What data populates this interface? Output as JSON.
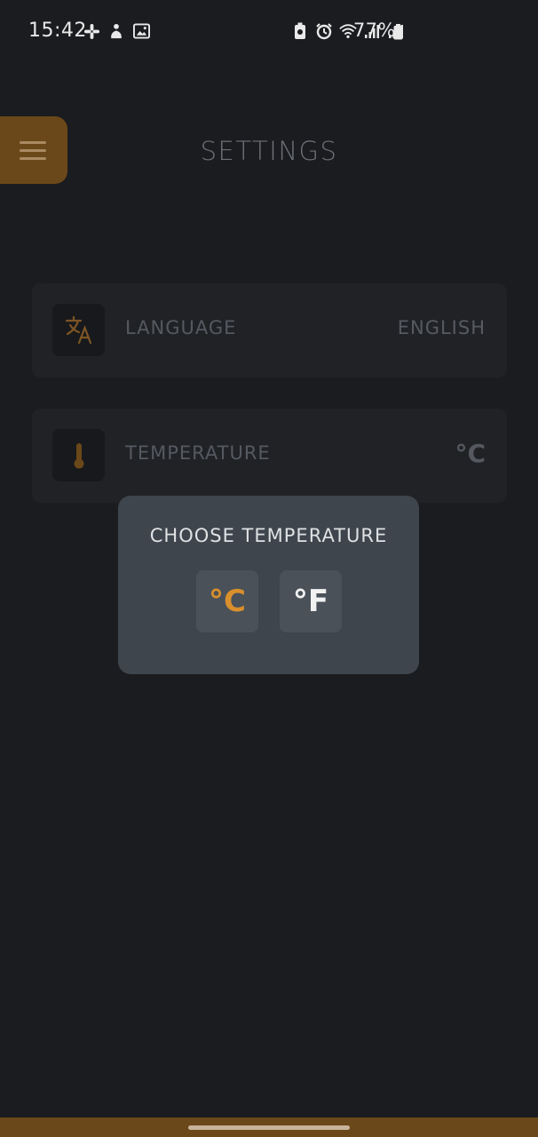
{
  "status_bar": {
    "time": "15:42",
    "battery": "77%",
    "left_icons": [
      "slack-icon",
      "app-notification-icon",
      "gallery-icon"
    ],
    "right_icons": [
      "battery-saver-icon",
      "alarm-icon",
      "wifi-icon",
      "signal-icon",
      "signal-icon"
    ]
  },
  "header": {
    "title": "SETTINGS",
    "menu_icon": "hamburger-menu-icon"
  },
  "settings": {
    "language": {
      "icon": "translate-icon",
      "label": "LANGUAGE",
      "value": "ENGLISH"
    },
    "temperature": {
      "icon": "thermometer-icon",
      "label": "TEMPERATURE",
      "value": "°C"
    }
  },
  "dialog": {
    "title": "CHOOSE TEMPERATURE",
    "options": [
      {
        "label": "°C",
        "selected": true
      },
      {
        "label": "°F",
        "selected": false
      }
    ]
  },
  "colors": {
    "background": "#1a1c1f",
    "accent": "#d98f2c",
    "accent_dark": "#6b4819",
    "card": "#202226",
    "dialog": "#3e454d"
  }
}
